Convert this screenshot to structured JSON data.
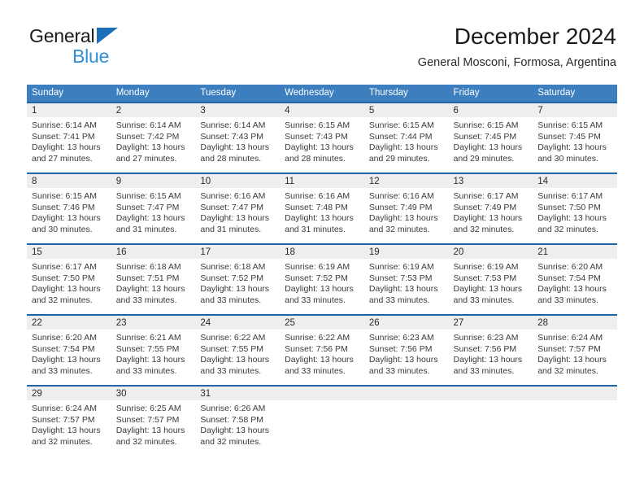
{
  "brand": {
    "name_part1": "General",
    "name_part2": "Blue",
    "triangle_icon": "triangle-icon"
  },
  "header": {
    "title": "December 2024",
    "subtitle": "General Mosconi, Formosa, Argentina"
  },
  "colors": {
    "header_blue": "#3c7ebe",
    "row_border_blue": "#1f64a8",
    "daynum_strip": "#eeeeee",
    "brand_blue": "#2f8fd8",
    "triangle_blue": "#1d70b8",
    "text": "#3a3a3a"
  },
  "weekdays": [
    "Sunday",
    "Monday",
    "Tuesday",
    "Wednesday",
    "Thursday",
    "Friday",
    "Saturday"
  ],
  "weeks": [
    [
      {
        "day": "1",
        "sunrise": "Sunrise: 6:14 AM",
        "sunset": "Sunset: 7:41 PM",
        "daylight1": "Daylight: 13 hours",
        "daylight2": "and 27 minutes."
      },
      {
        "day": "2",
        "sunrise": "Sunrise: 6:14 AM",
        "sunset": "Sunset: 7:42 PM",
        "daylight1": "Daylight: 13 hours",
        "daylight2": "and 27 minutes."
      },
      {
        "day": "3",
        "sunrise": "Sunrise: 6:14 AM",
        "sunset": "Sunset: 7:43 PM",
        "daylight1": "Daylight: 13 hours",
        "daylight2": "and 28 minutes."
      },
      {
        "day": "4",
        "sunrise": "Sunrise: 6:15 AM",
        "sunset": "Sunset: 7:43 PM",
        "daylight1": "Daylight: 13 hours",
        "daylight2": "and 28 minutes."
      },
      {
        "day": "5",
        "sunrise": "Sunrise: 6:15 AM",
        "sunset": "Sunset: 7:44 PM",
        "daylight1": "Daylight: 13 hours",
        "daylight2": "and 29 minutes."
      },
      {
        "day": "6",
        "sunrise": "Sunrise: 6:15 AM",
        "sunset": "Sunset: 7:45 PM",
        "daylight1": "Daylight: 13 hours",
        "daylight2": "and 29 minutes."
      },
      {
        "day": "7",
        "sunrise": "Sunrise: 6:15 AM",
        "sunset": "Sunset: 7:45 PM",
        "daylight1": "Daylight: 13 hours",
        "daylight2": "and 30 minutes."
      }
    ],
    [
      {
        "day": "8",
        "sunrise": "Sunrise: 6:15 AM",
        "sunset": "Sunset: 7:46 PM",
        "daylight1": "Daylight: 13 hours",
        "daylight2": "and 30 minutes."
      },
      {
        "day": "9",
        "sunrise": "Sunrise: 6:15 AM",
        "sunset": "Sunset: 7:47 PM",
        "daylight1": "Daylight: 13 hours",
        "daylight2": "and 31 minutes."
      },
      {
        "day": "10",
        "sunrise": "Sunrise: 6:16 AM",
        "sunset": "Sunset: 7:47 PM",
        "daylight1": "Daylight: 13 hours",
        "daylight2": "and 31 minutes."
      },
      {
        "day": "11",
        "sunrise": "Sunrise: 6:16 AM",
        "sunset": "Sunset: 7:48 PM",
        "daylight1": "Daylight: 13 hours",
        "daylight2": "and 31 minutes."
      },
      {
        "day": "12",
        "sunrise": "Sunrise: 6:16 AM",
        "sunset": "Sunset: 7:49 PM",
        "daylight1": "Daylight: 13 hours",
        "daylight2": "and 32 minutes."
      },
      {
        "day": "13",
        "sunrise": "Sunrise: 6:17 AM",
        "sunset": "Sunset: 7:49 PM",
        "daylight1": "Daylight: 13 hours",
        "daylight2": "and 32 minutes."
      },
      {
        "day": "14",
        "sunrise": "Sunrise: 6:17 AM",
        "sunset": "Sunset: 7:50 PM",
        "daylight1": "Daylight: 13 hours",
        "daylight2": "and 32 minutes."
      }
    ],
    [
      {
        "day": "15",
        "sunrise": "Sunrise: 6:17 AM",
        "sunset": "Sunset: 7:50 PM",
        "daylight1": "Daylight: 13 hours",
        "daylight2": "and 32 minutes."
      },
      {
        "day": "16",
        "sunrise": "Sunrise: 6:18 AM",
        "sunset": "Sunset: 7:51 PM",
        "daylight1": "Daylight: 13 hours",
        "daylight2": "and 33 minutes."
      },
      {
        "day": "17",
        "sunrise": "Sunrise: 6:18 AM",
        "sunset": "Sunset: 7:52 PM",
        "daylight1": "Daylight: 13 hours",
        "daylight2": "and 33 minutes."
      },
      {
        "day": "18",
        "sunrise": "Sunrise: 6:19 AM",
        "sunset": "Sunset: 7:52 PM",
        "daylight1": "Daylight: 13 hours",
        "daylight2": "and 33 minutes."
      },
      {
        "day": "19",
        "sunrise": "Sunrise: 6:19 AM",
        "sunset": "Sunset: 7:53 PM",
        "daylight1": "Daylight: 13 hours",
        "daylight2": "and 33 minutes."
      },
      {
        "day": "20",
        "sunrise": "Sunrise: 6:19 AM",
        "sunset": "Sunset: 7:53 PM",
        "daylight1": "Daylight: 13 hours",
        "daylight2": "and 33 minutes."
      },
      {
        "day": "21",
        "sunrise": "Sunrise: 6:20 AM",
        "sunset": "Sunset: 7:54 PM",
        "daylight1": "Daylight: 13 hours",
        "daylight2": "and 33 minutes."
      }
    ],
    [
      {
        "day": "22",
        "sunrise": "Sunrise: 6:20 AM",
        "sunset": "Sunset: 7:54 PM",
        "daylight1": "Daylight: 13 hours",
        "daylight2": "and 33 minutes."
      },
      {
        "day": "23",
        "sunrise": "Sunrise: 6:21 AM",
        "sunset": "Sunset: 7:55 PM",
        "daylight1": "Daylight: 13 hours",
        "daylight2": "and 33 minutes."
      },
      {
        "day": "24",
        "sunrise": "Sunrise: 6:22 AM",
        "sunset": "Sunset: 7:55 PM",
        "daylight1": "Daylight: 13 hours",
        "daylight2": "and 33 minutes."
      },
      {
        "day": "25",
        "sunrise": "Sunrise: 6:22 AM",
        "sunset": "Sunset: 7:56 PM",
        "daylight1": "Daylight: 13 hours",
        "daylight2": "and 33 minutes."
      },
      {
        "day": "26",
        "sunrise": "Sunrise: 6:23 AM",
        "sunset": "Sunset: 7:56 PM",
        "daylight1": "Daylight: 13 hours",
        "daylight2": "and 33 minutes."
      },
      {
        "day": "27",
        "sunrise": "Sunrise: 6:23 AM",
        "sunset": "Sunset: 7:56 PM",
        "daylight1": "Daylight: 13 hours",
        "daylight2": "and 33 minutes."
      },
      {
        "day": "28",
        "sunrise": "Sunrise: 6:24 AM",
        "sunset": "Sunset: 7:57 PM",
        "daylight1": "Daylight: 13 hours",
        "daylight2": "and 32 minutes."
      }
    ],
    [
      {
        "day": "29",
        "sunrise": "Sunrise: 6:24 AM",
        "sunset": "Sunset: 7:57 PM",
        "daylight1": "Daylight: 13 hours",
        "daylight2": "and 32 minutes."
      },
      {
        "day": "30",
        "sunrise": "Sunrise: 6:25 AM",
        "sunset": "Sunset: 7:57 PM",
        "daylight1": "Daylight: 13 hours",
        "daylight2": "and 32 minutes."
      },
      {
        "day": "31",
        "sunrise": "Sunrise: 6:26 AM",
        "sunset": "Sunset: 7:58 PM",
        "daylight1": "Daylight: 13 hours",
        "daylight2": "and 32 minutes."
      },
      {
        "day": "",
        "sunrise": "",
        "sunset": "",
        "daylight1": "",
        "daylight2": "",
        "empty": true
      },
      {
        "day": "",
        "sunrise": "",
        "sunset": "",
        "daylight1": "",
        "daylight2": "",
        "empty": true
      },
      {
        "day": "",
        "sunrise": "",
        "sunset": "",
        "daylight1": "",
        "daylight2": "",
        "empty": true
      },
      {
        "day": "",
        "sunrise": "",
        "sunset": "",
        "daylight1": "",
        "daylight2": "",
        "empty": true
      }
    ]
  ]
}
